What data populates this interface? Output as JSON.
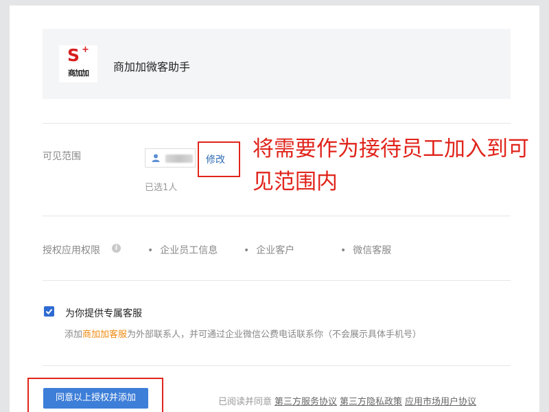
{
  "app": {
    "logo_text": "商加加",
    "name": "商加加微客助手"
  },
  "visibility": {
    "label": "可见范围",
    "edit_label": "修改",
    "selected_count": "已选1人",
    "annotation": "将需要作为接待员工加入到可见范围内"
  },
  "permissions": {
    "label": "授权应用权限",
    "items": [
      "企业员工信息",
      "企业客户",
      "微信客服"
    ]
  },
  "customer_service": {
    "checked": true,
    "label": "为你提供专属客服",
    "desc_prefix": "添加",
    "desc_highlight": "商加加客服",
    "desc_suffix": "为外部联系人，并可通过企业微信公费电话联系你（不会展示具体手机号）"
  },
  "footer": {
    "submit_label": "同意以上授权并添加",
    "agree_prefix": "已阅读并同意",
    "links": [
      "第三方服务协议",
      "第三方隐私政策",
      "应用市场用户协议"
    ]
  },
  "colors": {
    "accent": "#3d7ed8",
    "annotation_red": "#e0241b",
    "highlight_orange": "#f08a10"
  }
}
